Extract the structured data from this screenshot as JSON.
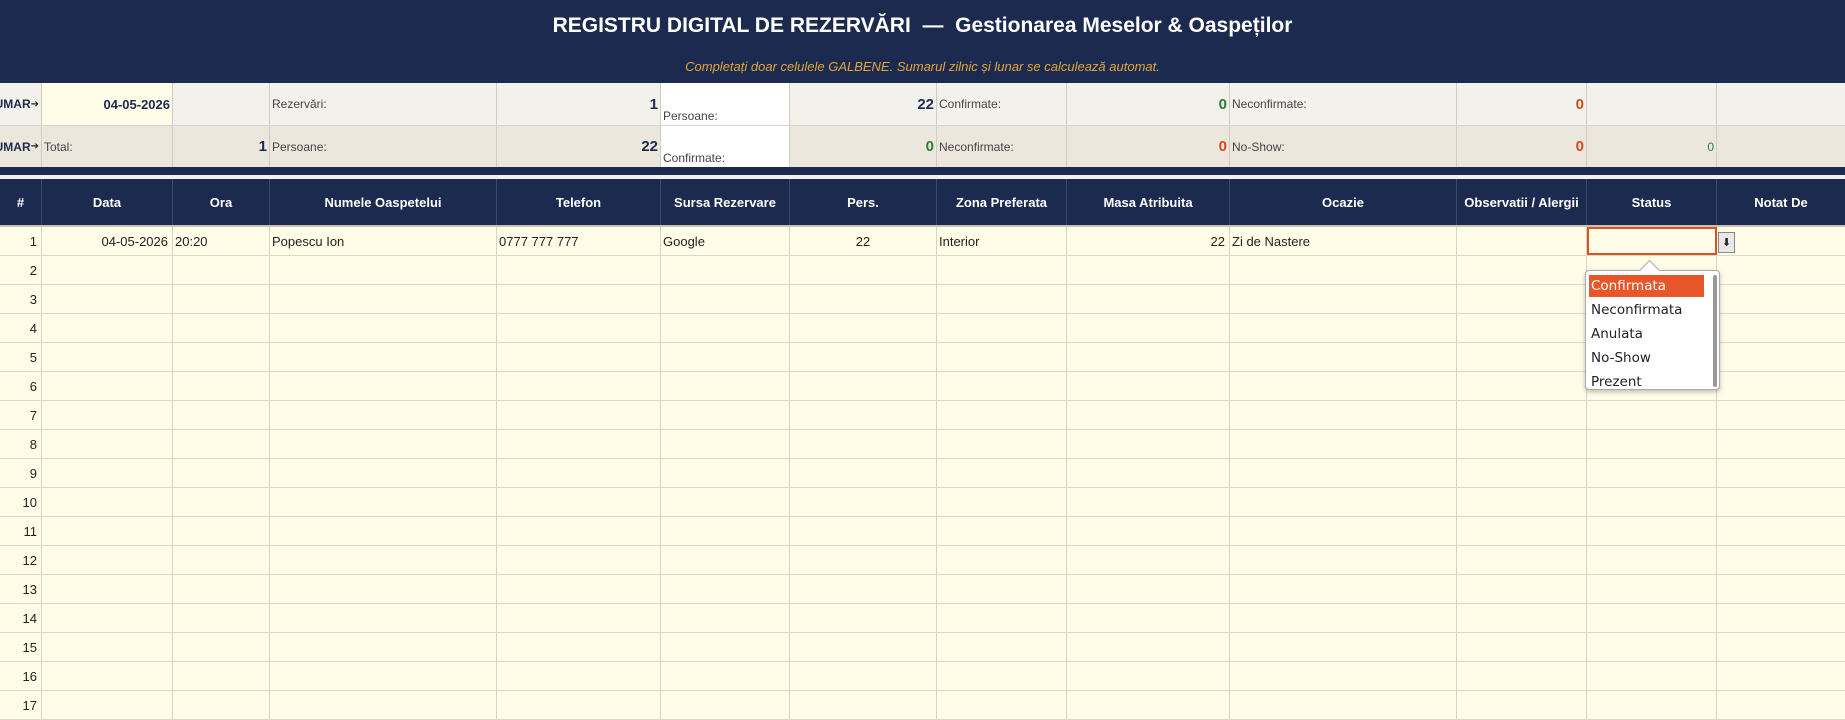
{
  "header": {
    "title": "REGISTRU DIGITAL DE REZERVĂRI  —  Gestionarea Meselor & Oaspeților",
    "subtitle": "Completați doar celulele GALBENE. Sumarul zilnic și lunar se calculează automat."
  },
  "summary_daily": {
    "label": "SUMAR",
    "date": "04-05-2026",
    "reservations_label": "Rezervări:",
    "reservations_value": "1",
    "persons_label": "Persoane:",
    "persons_value": "22",
    "confirmed_label": "Confirmate:",
    "confirmed_value": "0",
    "unconfirmed_label": "Neconfirmate:",
    "unconfirmed_value": "0"
  },
  "summary_monthly": {
    "label": "SUMAR",
    "total_label": "Total:",
    "total_value": "1",
    "persons_label": "Persoane:",
    "persons_value": "22",
    "confirmed_label": "Confirmate:",
    "confirmed_value": "0",
    "unconfirmed_label": "Neconfirmate:",
    "unconfirmed_value": "0",
    "noshow_label": "No-Show:",
    "noshow_value": "0",
    "extra_value": "0"
  },
  "columns": [
    "#",
    "Data",
    "Ora",
    "Numele Oaspetelui",
    "Telefon",
    "Sursa Rezervare",
    "Pers.",
    "Zona Preferata",
    "Masa Atribuita",
    "Ocazie",
    "Observatii / Alergii",
    "Status",
    "Notat De"
  ],
  "rows": [
    {
      "n": "1",
      "data": "04-05-2026",
      "ora": "20:20",
      "nume": "Popescu Ion",
      "telefon": "0777 777 777",
      "sursa": "Google",
      "pers": "22",
      "zona": "Interior",
      "masa": "22",
      "ocazie": "Zi de Nastere",
      "obs": "",
      "status": "",
      "notat": ""
    },
    {
      "n": "2"
    },
    {
      "n": "3"
    },
    {
      "n": "4"
    },
    {
      "n": "5"
    },
    {
      "n": "6"
    },
    {
      "n": "7"
    },
    {
      "n": "8"
    },
    {
      "n": "9"
    },
    {
      "n": "10"
    },
    {
      "n": "11"
    },
    {
      "n": "12"
    },
    {
      "n": "13"
    },
    {
      "n": "14"
    },
    {
      "n": "15"
    },
    {
      "n": "16"
    },
    {
      "n": "17"
    }
  ],
  "status_dropdown": {
    "options": [
      "Confirmata",
      "Neconfirmata",
      "Anulata",
      "No-Show",
      "Prezent"
    ],
    "highlighted": "Confirmata",
    "button_icon": "download-arrow-icon"
  },
  "colors": {
    "navy": "#1b2a4e",
    "yellow_cell": "#fffce8",
    "accent_orange": "#d9541e",
    "green": "#2e7d32",
    "red": "#d04a1c",
    "subtitle_gold": "#e4a53a"
  }
}
